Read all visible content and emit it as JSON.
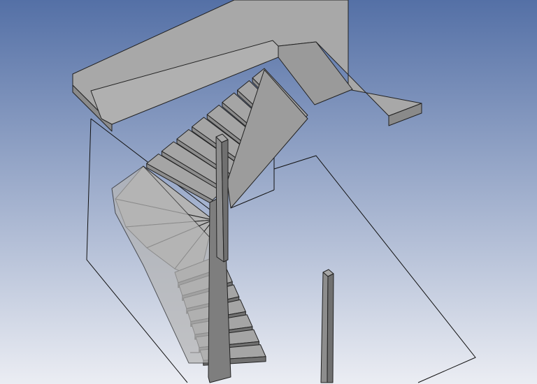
{
  "viewport": {
    "background_top": "#5470a6",
    "background_bottom": "#ebedf3"
  },
  "palette": {
    "top_face": "#a5a5a5",
    "side_face": "#8c8c8c",
    "dark_face": "#707070",
    "ghost_face": "#b4b4b4",
    "edge": "#1a1a1a"
  },
  "model": {
    "landing_slab": "landing-slab",
    "upper_flight_treads": 8,
    "winder_treads": 5,
    "lower_flight_treads": 7,
    "posts": [
      "newel-post-upper",
      "newel-post-lower"
    ]
  }
}
